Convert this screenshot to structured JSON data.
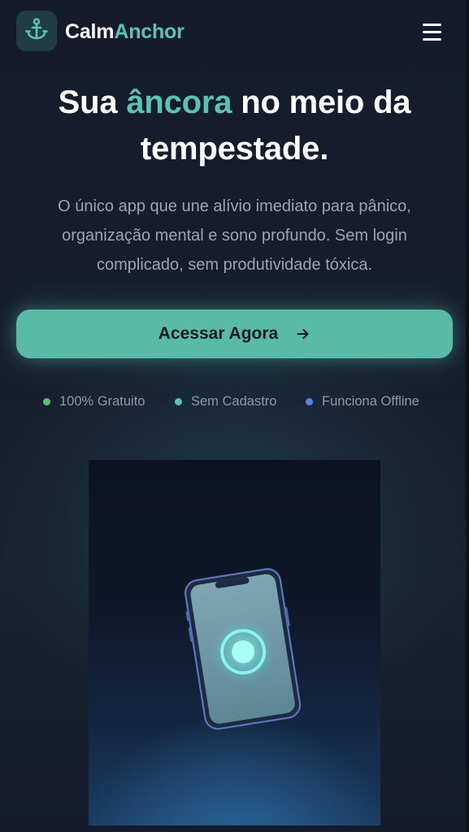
{
  "header": {
    "brand_part1": "Calm",
    "brand_part2": "Anchor",
    "logo_icon": "anchor-icon",
    "menu_icon": "hamburger-menu-icon"
  },
  "hero": {
    "title_part1": "Sua",
    "title_accent": "âncora",
    "title_part2": "no meio da",
    "title_line2": "tempestade.",
    "subtitle_line1": "O único app que une alívio imediato para pânico,",
    "subtitle_line2": "organização mental e sono profundo. Sem login",
    "subtitle_line3": "complicado, sem produtividade tóxica."
  },
  "cta": {
    "label": "Acessar Agora",
    "icon": "arrow-right-icon"
  },
  "features": [
    {
      "label": "100% Gratuito",
      "dot_color": "#5fbf7a"
    },
    {
      "label": "Sem Cadastro",
      "dot_color": "#5cc4ad"
    },
    {
      "label": "Funciona Offline",
      "dot_color": "#5b7fe0"
    }
  ],
  "colors": {
    "background": "#151b2c",
    "accent": "#5cc4ad",
    "button": "#59bba6",
    "text_primary": "#ffffff",
    "text_muted": "#9aa4b3"
  }
}
